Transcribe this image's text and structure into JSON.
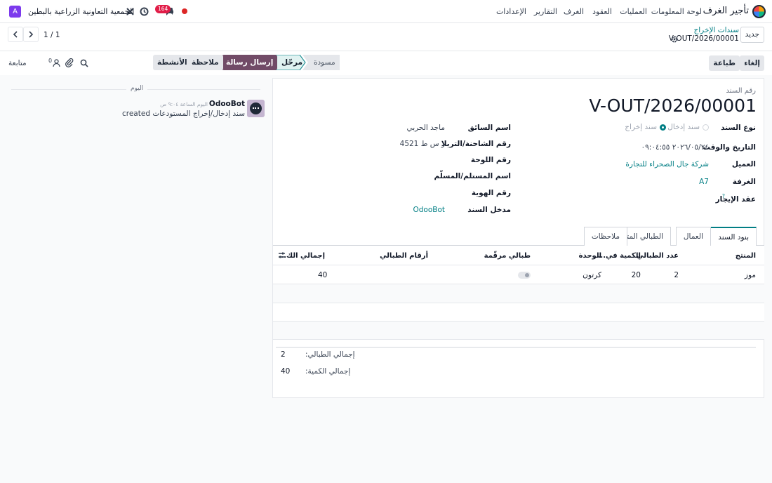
{
  "navbar": {
    "app_name": "تأجير الغرف",
    "menu": [
      "لوحة المعلومات",
      "العمليات",
      "العقود",
      "الغرف",
      "التقارير",
      "الإعدادات"
    ],
    "company": "الجمعية التعاونية الزراعية بالبطين",
    "avatar_letter": "A",
    "messages_badge": "164"
  },
  "control": {
    "new_label": "جديد",
    "breadcrumb_parent": "سندات الإخراج",
    "breadcrumb_current": "V-OUT/2026/00001",
    "pager": "1 / 1"
  },
  "chatter_buttons": {
    "send_message": "إرسال رسالة",
    "log_note": "ملاحظة",
    "activities": "الأنشطة",
    "follow": "متابعة",
    "followers_count": "0"
  },
  "actions": {
    "cancel": "إلغاء",
    "print": "طباعة",
    "status_posted": "مرحّل",
    "status_draft": "مسودة"
  },
  "form": {
    "doc_number_label": "رقم السند",
    "doc_number": "V-OUT/2026/00001",
    "doc_type_label": "نوع السند",
    "doc_type_in": "سند إدخال",
    "doc_type_out": "سند إخراج",
    "datetime_label": "التاريخ والوقت",
    "datetime": "٢٠٢٦/٠٥/٢٤ ٠٩:٠٤:٥٥",
    "customer_label": "العميل",
    "customer": "شركة جال الصحراء للتجارة",
    "room_label": "الغرفة",
    "room": "A7",
    "contract_label": "عقد الإيجار",
    "contract_help": "?",
    "driver_label": "اسم السائق",
    "driver": "ماجد الحربي",
    "truck_label": "رقم الشاحنة/التريلا",
    "truck": "ر س ط 4521",
    "plate_label": "رقم اللوحة",
    "receiver_label": "اسم المستلم/المسلّم",
    "id_label": "رقم الهوية",
    "entered_by_label": "مدخل السند",
    "entered_by": "OdooBot"
  },
  "tabs": [
    "بنود السند",
    "العمال",
    "الطبالي المتأثرة",
    "ملاحظات"
  ],
  "lines_table": {
    "headers": [
      "المنتج",
      "عدد الطبالي",
      "الكمية في...",
      "الوحدة",
      "طبالي مرقّمة",
      "أرقام الطبالي",
      "إجمالي الك..."
    ],
    "rows": [
      {
        "product": "موز",
        "pallets": "2",
        "qty_per": "20",
        "unit": "كرتون",
        "numbered": false,
        "pallet_numbers": "",
        "total": "40"
      }
    ]
  },
  "totals": {
    "pallets_label": "إجمالي الطبالي:",
    "pallets_value": "2",
    "qty_label": "إجمالي الكمية:",
    "qty_value": "40"
  },
  "chatter": {
    "today_label": "اليوم",
    "author": "OdooBot",
    "time": "اليوم الساعة ٩:٠٤ ص",
    "message": "سند إدخال/إخراج المستودعات",
    "message_suffix": "created"
  },
  "colors": {
    "primary": "#714b67",
    "link": "#017e84",
    "badge": "#e11d48"
  }
}
